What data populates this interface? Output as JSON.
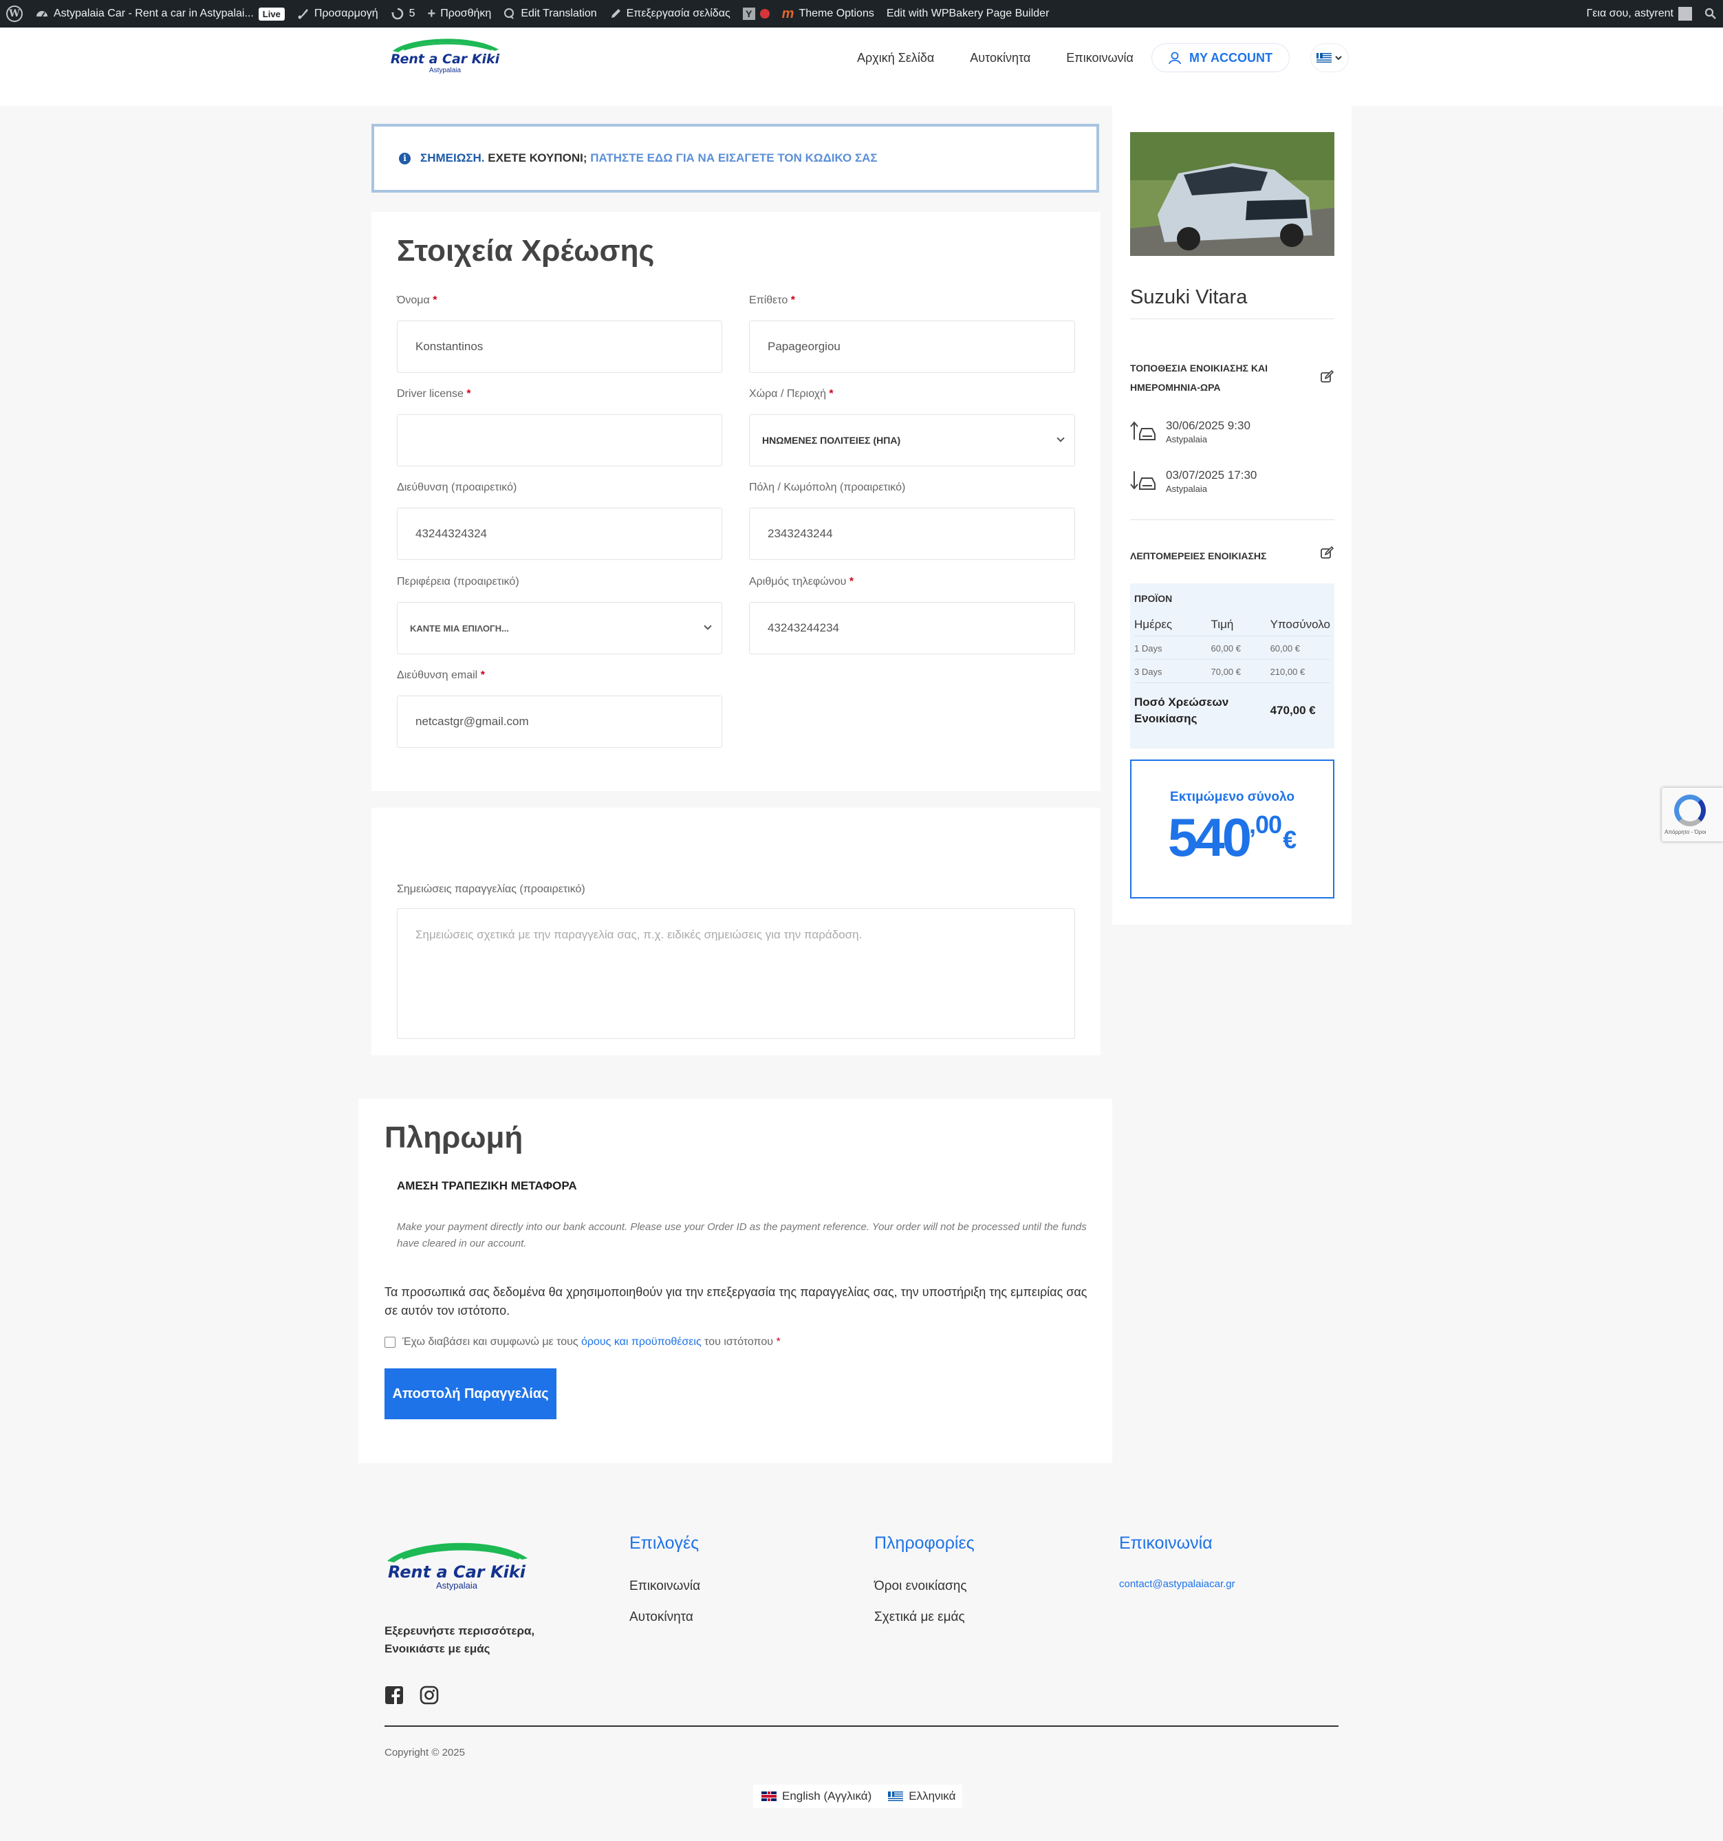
{
  "admin_bar": {
    "site_name": "Astypalaia Car - Rent a car in Astypalai...",
    "live_badge": "Live",
    "customize": "Προσαρμογή",
    "updates_count": "5",
    "add_new": "Προσθήκη",
    "edit_translation": "Edit Translation",
    "edit_page": "Επεξεργασία σελίδας",
    "theme_options": "Theme Options",
    "wpbakery": "Edit with WPBakery Page Builder",
    "greeting": "Γεια σου, astyrent"
  },
  "header": {
    "logo_text": "Rent a Car Kiki",
    "logo_subtext": "Astypalaia",
    "nav": [
      "Αρχική Σελίδα",
      "Αυτοκίνητα",
      "Επικοινωνία"
    ],
    "account_label": "MY ACCOUNT"
  },
  "coupon": {
    "label": "ΣΗΜΕΙΩΣΗ.",
    "question": "ΕΧΕΤΕ ΚΟΥΠΟΝΙ;",
    "link": "ΠΑΤΗΣΤΕ ΕΔΩ ΓΙΑ ΝΑ ΕΙΣΑΓΕΤΕ ΤΟΝ ΚΩΔΙΚΟ ΣΑΣ"
  },
  "billing": {
    "title": "Στοιχεία Χρέωσης",
    "first_name": {
      "label": "Όνομα",
      "value": "Konstantinos"
    },
    "last_name": {
      "label": "Επίθετο",
      "value": "Papageorgiou"
    },
    "driver_license": {
      "label": "Driver license",
      "value": ""
    },
    "country": {
      "label": "Χώρα / Περιοχή",
      "value": "ΗΝΩΜΕΝΕΣ ΠΟΛΙΤΕΙΕΣ (ΗΠΑ)"
    },
    "address": {
      "label": "Διεύθυνση (προαιρετικό)",
      "value": "43244324324"
    },
    "city": {
      "label": "Πόλη / Κωμόπολη (προαιρετικό)",
      "value": "2343243244"
    },
    "region": {
      "label": "Περιφέρεια (προαιρετικό)",
      "value": "ΚΑΝΤΕ ΜΙΑ ΕΠΙΛΟΓΗ..."
    },
    "phone": {
      "label": "Αριθμός τηλεφώνου",
      "value": "43243244234"
    },
    "email": {
      "label": "Διεύθυνση email",
      "value": "netcastgr@gmail.com"
    }
  },
  "notes": {
    "label": "Σημειώσεις παραγγελίας (προαιρετικό)",
    "placeholder": "Σημειώσεις σχετικά με την παραγγελία σας, π.χ. ειδικές σημειώσεις για την παράδοση."
  },
  "payment": {
    "title": "Πληρωμή",
    "method": "ΑΜΕΣΗ ΤΡΑΠΕΖΙΚΗ ΜΕΤΑΦΟΡΑ",
    "description": "Make your payment directly into our bank account. Please use your Order ID as the payment reference. Your order will not be processed until the funds have cleared in our account.",
    "privacy": "Τα προσωπικά σας δεδομένα θα χρησιμοποιηθούν για την επεξεργασία της παραγγελίας σας, την υποστήριξη της εμπειρίας σας σε αυτόν τον ιστότοπο.",
    "terms_prefix": "Έχω διαβάσει και συμφωνώ με τους",
    "terms_link": "όρους και προϋποθέσεις",
    "terms_suffix": "του ιστότοπου",
    "required_mark": "*",
    "submit": "Αποστολή Παραγγελίας"
  },
  "sidebar": {
    "car_name": "Suzuki Vitara",
    "location_title": "ΤΟΠΟΘΕΣΙΑ ΕΝΟΙΚΙΑΣΗΣ ΚΑΙ ΗΜΕΡΟΜΗΝΙΑ-ΩΡΑ",
    "pickup": {
      "datetime": "30/06/2025 9:30",
      "place": "Astypalaia"
    },
    "dropoff": {
      "datetime": "03/07/2025 17:30",
      "place": "Astypalaia"
    },
    "details_title": "ΛΕΠΤΟΜΕΡΕΙΕΣ ΕΝΟΙΚΙΑΣΗΣ",
    "product_label": "ΠΡΟΪΟΝ",
    "table_headers": [
      "Ημέρες",
      "Τιμή",
      "Υποσύνολο"
    ],
    "rows": [
      {
        "days": "1 Days",
        "price": "60,00 €",
        "subtotal": "60,00 €"
      },
      {
        "days": "3 Days",
        "price": "70,00 €",
        "subtotal": "210,00 €"
      }
    ],
    "total_label": "Ποσό Χρεώσεων Ενοικίασης",
    "total_value": "470,00 €",
    "estimated_label": "Εκτιμώμενο σύνολο",
    "estimated_int": "540",
    "estimated_dec": ",00",
    "estimated_currency": "€"
  },
  "recaptcha": {
    "text": "Απόρρητο - Όροι"
  },
  "footer": {
    "logo_text": "Rent a Car Kiki",
    "logo_subtext": "Astypalaia",
    "tagline_1": "Εξερευνήστε περισσότερα,",
    "tagline_2": "Ενοικιάστε με εμάς",
    "col1_title": "Επιλογές",
    "col1_links": [
      "Επικοινωνία",
      "Αυτοκίνητα"
    ],
    "col2_title": "Πληροφορίες",
    "col2_links": [
      "Όροι ενοικίασης",
      "Σχετικά με εμάς"
    ],
    "col3_title": "Επικοινωνία",
    "email": "contact@astypalaiacar.gr",
    "copyright": "Copyright © 2025",
    "lang_en": "English (Αγγλικά)",
    "lang_el": "Ελληνικά"
  }
}
